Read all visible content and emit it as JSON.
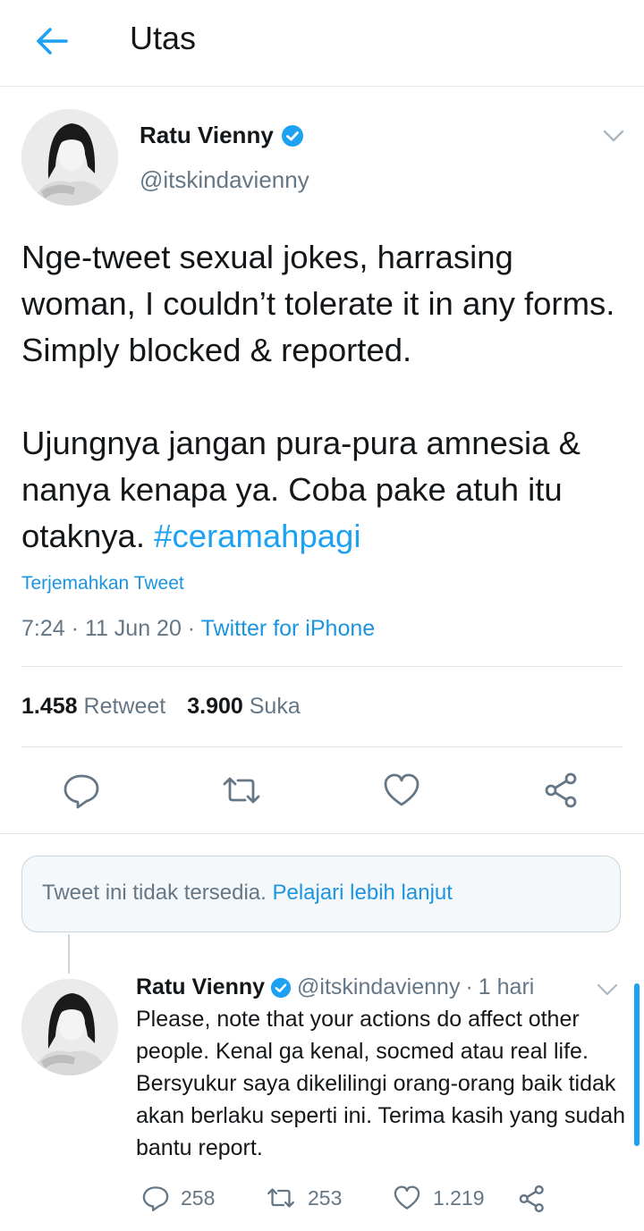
{
  "header": {
    "title": "Utas"
  },
  "tweet": {
    "author_name": "Ratu Vienny",
    "author_handle": "@itskindavienny",
    "paragraph1": "Nge-tweet sexual jokes, harrasing woman, I couldn’t tolerate it in any forms. Simply blocked & reported.",
    "paragraph2": "Ujungnya jangan pura-pura amnesia & nanya kenapa ya. Coba pake atuh itu otaknya.",
    "hashtag": "#ceramahpagi",
    "translate_label": "Terjemahkan Tweet",
    "time": "7:24",
    "date": "11 Jun 20",
    "source": "Twitter for iPhone",
    "retweet_count": "1.458",
    "retweet_label": "Retweet",
    "like_count": "3.900",
    "like_label": "Suka"
  },
  "unavailable": {
    "text": "Tweet ini tidak tersedia.",
    "link": "Pelajari lebih lanjut"
  },
  "reply": {
    "author_name": "Ratu Vienny",
    "author_handle": "@itskindavienny",
    "time_ago": "1 hari",
    "text": "Please, note that your actions do affect other people. Kenal ga kenal, socmed atau real life. Bersyukur saya dikelilingi orang-orang baik tidak akan berlaku seperti ini. Terima kasih yang sudah bantu report.",
    "reply_count": "258",
    "retweet_count": "253",
    "like_count": "1.219"
  },
  "colors": {
    "accent": "#1da1f2",
    "link": "#1b95e0",
    "muted": "#657786",
    "divider": "#e1e8ed"
  },
  "icons": [
    "back-arrow-icon",
    "verified-badge-icon",
    "chevron-down-icon",
    "reply-icon",
    "retweet-icon",
    "like-icon",
    "share-icon"
  ]
}
